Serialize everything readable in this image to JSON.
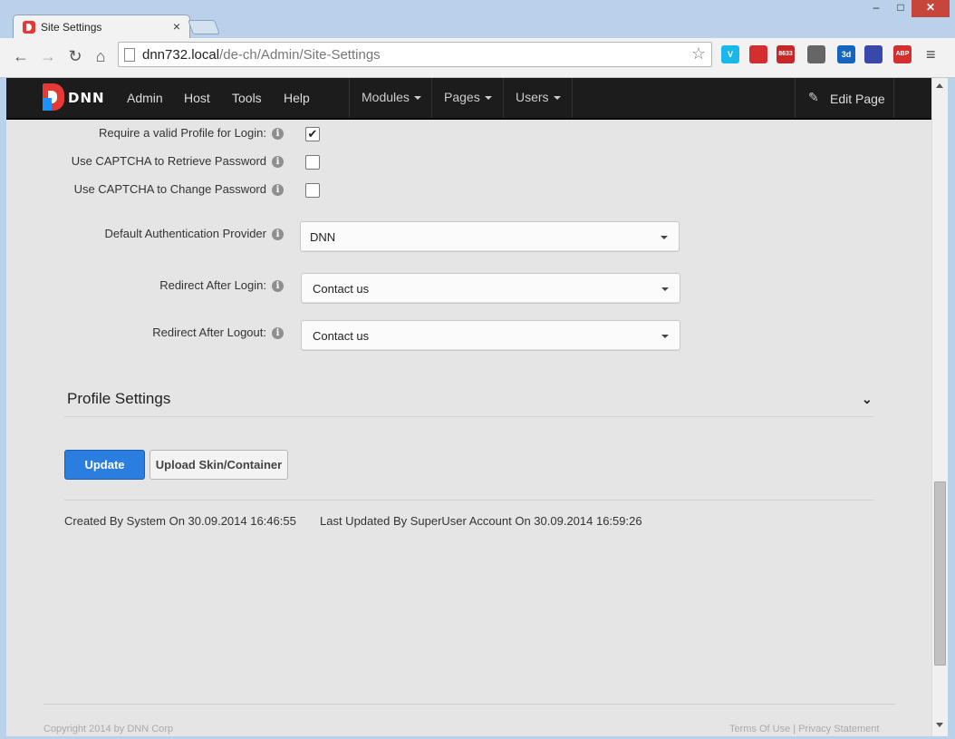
{
  "browser": {
    "tab_title": "Site Settings",
    "tab_close": "×",
    "window": {
      "minimize": "–",
      "maximize": "□",
      "close": "✕"
    },
    "nav": {
      "back": "←",
      "forward": "→",
      "reload": "↻",
      "home": "⌂"
    },
    "url_host": "dnn732.local",
    "url_path": "/de-ch/Admin/Site-Settings",
    "star": "☆",
    "extensions": [
      {
        "name": "vimeo-icon",
        "label": "V",
        "color": "#1ab7ea"
      },
      {
        "name": "bookmark-icon",
        "label": "",
        "color": "#d32f2f"
      },
      {
        "name": "gmail-icon",
        "label": "8633",
        "color": "#c62828"
      },
      {
        "name": "keyboard-icon",
        "label": "",
        "color": "#666666"
      },
      {
        "name": "calendar-icon",
        "label": "3d",
        "color": "#1565c0"
      },
      {
        "name": "moon-icon",
        "label": "",
        "color": "#3949ab"
      },
      {
        "name": "adblock-icon",
        "label": "ABP",
        "color": "#d32f2f"
      }
    ],
    "menu": "≡"
  },
  "dnnbar": {
    "logo_text": "DNN",
    "links": [
      "Admin",
      "Host",
      "Tools",
      "Help"
    ],
    "menus": [
      "Modules",
      "Pages",
      "Users"
    ],
    "edit_page": "Edit Page",
    "pencil": "✎"
  },
  "settings": {
    "require_profile_label": "Require a valid Profile for Login:",
    "require_profile_checked": true,
    "captcha_retrieve_label": "Use CAPTCHA to Retrieve Password",
    "captcha_retrieve_checked": false,
    "captcha_change_label": "Use CAPTCHA to Change Password",
    "captcha_change_checked": false,
    "auth_provider_label": "Default Authentication Provider",
    "auth_provider_value": "DNN",
    "redirect_login_label": "Redirect After Login:",
    "redirect_login_value": "Contact us",
    "redirect_logout_label": "Redirect After Logout:",
    "redirect_logout_value": "Contact us",
    "info_glyph": "i",
    "check_glyph": "✔"
  },
  "profile_section": {
    "title": "Profile Settings",
    "chevron": "⌄"
  },
  "actions": {
    "update": "Update",
    "upload": "Upload Skin/Container"
  },
  "audit": {
    "created": "Created By System On 30.09.2014 16:46:55",
    "updated": "Last Updated By SuperUser Account On 30.09.2014 16:59:26"
  },
  "footer": {
    "copyright": "Copyright 2014 by DNN Corp",
    "links": "Terms Of Use | Privacy Statement"
  },
  "scrollbar": {
    "position": 0.61
  }
}
